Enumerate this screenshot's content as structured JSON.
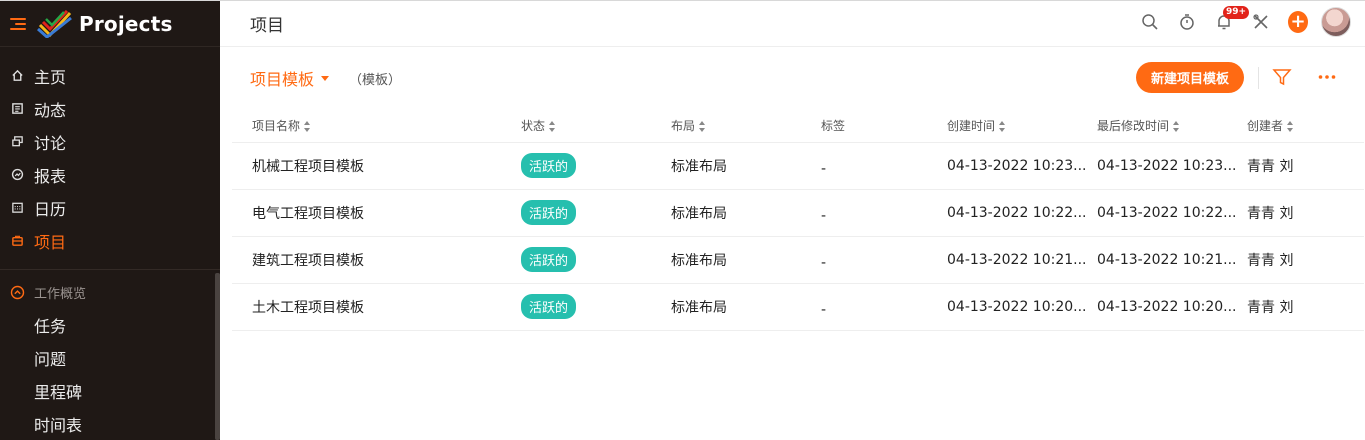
{
  "brand": {
    "name": "Projects",
    "accent": "#ff6a13"
  },
  "sidebar": {
    "items": [
      {
        "label": "主页",
        "icon": "home-icon"
      },
      {
        "label": "动态",
        "icon": "feed-icon"
      },
      {
        "label": "讨论",
        "icon": "discussion-icon"
      },
      {
        "label": "报表",
        "icon": "report-icon"
      },
      {
        "label": "日历",
        "icon": "calendar-icon"
      },
      {
        "label": "项目",
        "icon": "project-icon"
      }
    ],
    "section": {
      "title": "工作概览",
      "icon": "collapse-up-icon"
    },
    "sub_items": [
      "任务",
      "问题",
      "里程碑",
      "时间表"
    ]
  },
  "header": {
    "title": "项目",
    "notification_badge": "99+"
  },
  "toolbar": {
    "view_label": "项目模板",
    "view_hint": "（模板）",
    "new_button": "新建项目模板"
  },
  "table": {
    "columns": [
      "项目名称",
      "状态",
      "布局",
      "标签",
      "创建时间",
      "最后修改时间",
      "创建者"
    ],
    "rows": [
      [
        "机械工程项目模板",
        "活跃的",
        "标准布局",
        "-",
        "04-13-2022 10:23...",
        "04-13-2022 10:23...",
        "青青 刘"
      ],
      [
        "电气工程项目模板",
        "活跃的",
        "标准布局",
        "-",
        "04-13-2022 10:22...",
        "04-13-2022 10:22...",
        "青青 刘"
      ],
      [
        "建筑工程项目模板",
        "活跃的",
        "标准布局",
        "-",
        "04-13-2022 10:21...",
        "04-13-2022 10:21...",
        "青青 刘"
      ],
      [
        "土木工程项目模板",
        "活跃的",
        "标准布局",
        "-",
        "04-13-2022 10:20...",
        "04-13-2022 10:20...",
        "青青 刘"
      ]
    ],
    "status_color": "#26bfae"
  }
}
